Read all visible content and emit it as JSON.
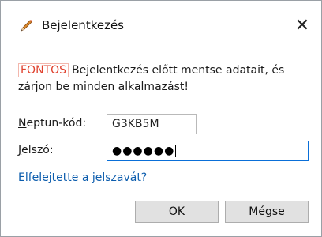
{
  "window": {
    "title": "Bejelentkezés",
    "title_icon": "pencil-icon",
    "close_glyph": "✕"
  },
  "message": {
    "badge": "FONTOS",
    "text": "Bejelentkezés előtt mentse adatait, és zárjon be minden alkalmazást!",
    "badge_color": "#e0412d"
  },
  "form": {
    "neptun_label_accel": "N",
    "neptun_label_rest": "eptun-kód:",
    "neptun_value": "G3KB5M",
    "password_label_accel": "J",
    "password_label_rest": "elszó:",
    "password_value": "●●●●●●"
  },
  "forgot_link": "Elfelejtette a jelszavát?",
  "buttons": {
    "ok": "OK",
    "cancel": "Mégse"
  },
  "colors": {
    "link": "#0b5cad",
    "focus_border": "#0a6fd8"
  }
}
